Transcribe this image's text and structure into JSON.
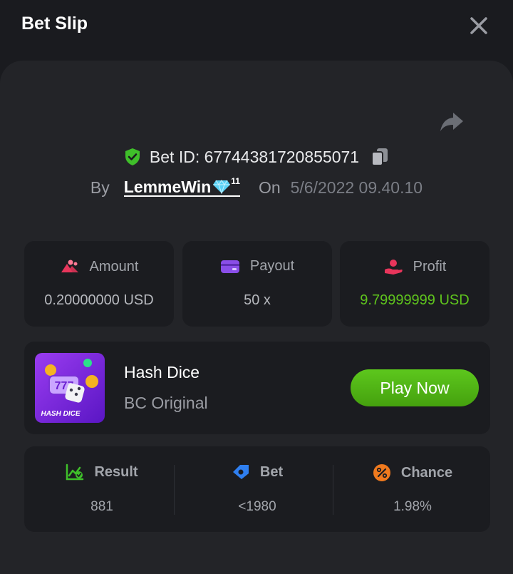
{
  "header": {
    "title": "Bet Slip"
  },
  "bet": {
    "id_text": "Bet ID: 67744381720855071",
    "by_label": "By",
    "username": "LemmeWin",
    "user_level": "11",
    "on_label": "On",
    "date": "5/6/2022 09.40.10"
  },
  "stats": {
    "amount": {
      "label": "Amount",
      "value": "0.20000000 USD"
    },
    "payout": {
      "label": "Payout",
      "value": "50 x"
    },
    "profit": {
      "label": "Profit",
      "value": "9.79999999 USD"
    }
  },
  "game": {
    "name": "Hash Dice",
    "provider": "BC Original",
    "thumb_caption": "HASH DICE",
    "play_label": "Play Now"
  },
  "result": {
    "result": {
      "label": "Result",
      "value": "881"
    },
    "bet": {
      "label": "Bet",
      "value": "<1980"
    },
    "chance": {
      "label": "Chance",
      "value": "1.98%"
    }
  },
  "colors": {
    "background": "#1a1b1f",
    "panel": "#232428",
    "card": "#1b1c20",
    "accent_green": "#5fc41d",
    "play_button": "#4fb311"
  },
  "icons": {
    "close": "close-icon",
    "share": "share-icon",
    "verified": "shield-check-icon",
    "copy": "copy-icon",
    "vip": "diamond-icon",
    "amount": "coins-icon",
    "payout": "wallet-icon",
    "profit": "hand-coin-icon",
    "result": "chart-check-icon",
    "bet": "target-icon",
    "chance": "percent-icon"
  }
}
